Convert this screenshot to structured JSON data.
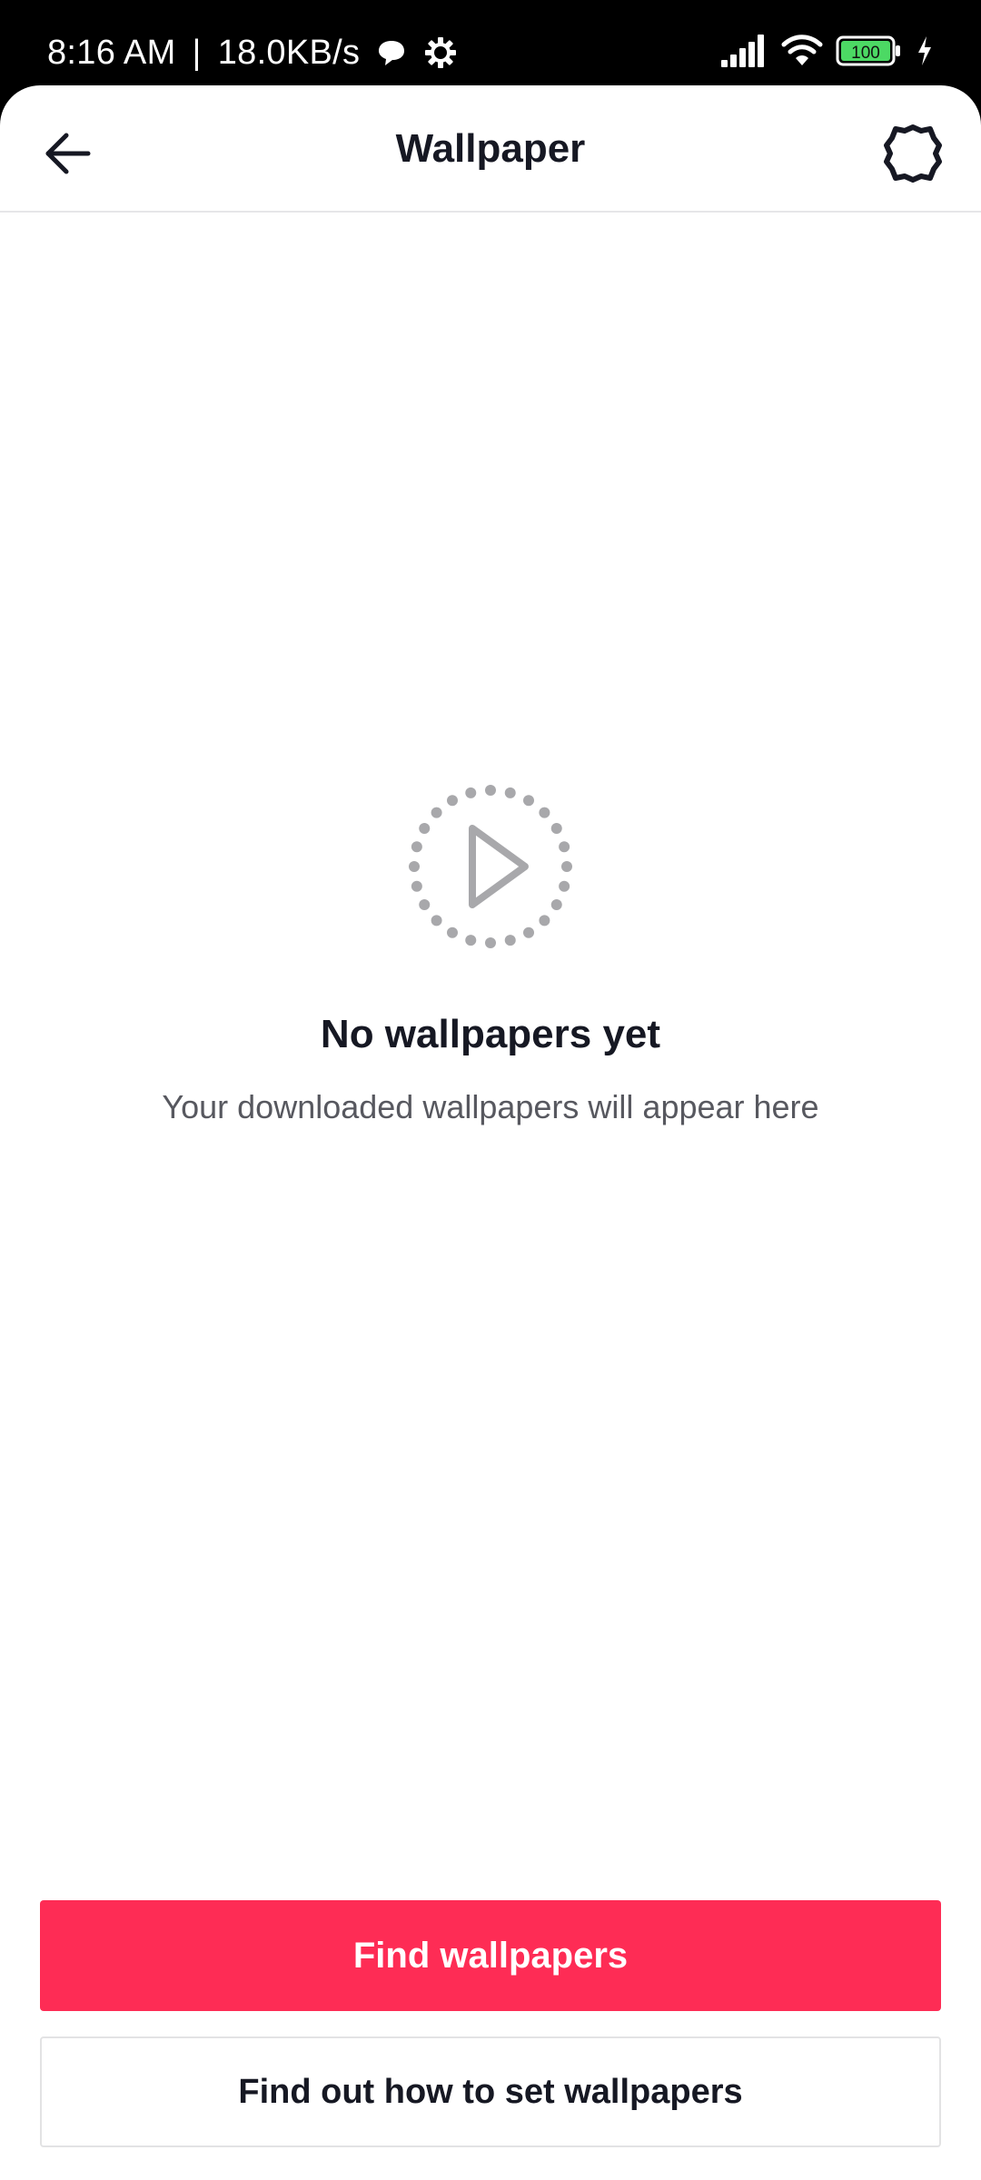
{
  "status_bar": {
    "time": "8:16 AM",
    "separator": "|",
    "network_speed": "18.0KB/s",
    "battery_level": "100",
    "icons": [
      "chat-bubble-icon",
      "gear-icon",
      "signal-icon",
      "wifi-icon",
      "battery-icon",
      "charging-icon"
    ]
  },
  "header": {
    "title": "Wallpaper",
    "back_icon": "arrow-left-icon",
    "settings_icon": "gear-icon"
  },
  "empty_state": {
    "icon": "dotted-play-icon",
    "title": "No wallpapers yet",
    "subtitle": "Your downloaded wallpapers will appear here"
  },
  "actions": {
    "primary_label": "Find wallpapers",
    "secondary_label": "Find out how to set wallpapers"
  },
  "colors": {
    "accent": "#fe2c55",
    "text_primary": "#161823",
    "text_secondary": "#57585f",
    "icon_muted": "#a8a8ab",
    "battery_fill": "#4cd964"
  }
}
